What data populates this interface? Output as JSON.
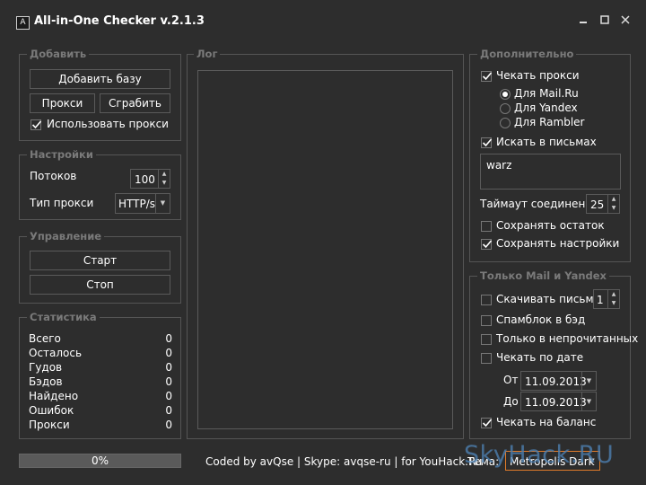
{
  "window": {
    "title": "All-in-One Checker v.2.1.3",
    "icon_glyph": "A"
  },
  "add_group": {
    "legend": "Добавить",
    "add_base": "Добавить базу",
    "proxy": "Прокси",
    "grab": "Сграбить",
    "use_proxy": "Использовать прокси",
    "use_proxy_checked": true
  },
  "settings_group": {
    "legend": "Настройки",
    "threads_label": "Потоков",
    "threads_value": "100",
    "proxy_type_label": "Тип прокси",
    "proxy_type_value": "HTTP/s"
  },
  "control_group": {
    "legend": "Управление",
    "start": "Старт",
    "stop": "Стоп"
  },
  "stats_group": {
    "legend": "Статистика",
    "rows": [
      {
        "label": "Всего",
        "value": "0"
      },
      {
        "label": "Осталось",
        "value": "0"
      },
      {
        "label": "Гудов",
        "value": "0"
      },
      {
        "label": "Бэдов",
        "value": "0"
      },
      {
        "label": "Найдено",
        "value": "0"
      },
      {
        "label": "Ошибок",
        "value": "0"
      },
      {
        "label": "Прокси",
        "value": "0"
      }
    ]
  },
  "log_group": {
    "legend": "Лог"
  },
  "extra_group": {
    "legend": "Дополнительно",
    "check_proxy": "Чекать прокси",
    "check_proxy_checked": true,
    "radios": [
      {
        "label": "Для Mail.Ru",
        "selected": true
      },
      {
        "label": "Для Yandex",
        "selected": false
      },
      {
        "label": "Для Rambler",
        "selected": false
      }
    ],
    "search_in_letters": "Искать в письмах",
    "search_in_letters_checked": true,
    "search_text": "warz",
    "timeout_label": "Таймаут соединения",
    "timeout_value": "25",
    "save_rest": "Сохранять остаток",
    "save_rest_checked": false,
    "save_settings": "Сохранять настройки",
    "save_settings_checked": true
  },
  "mail_yandex_group": {
    "legend": "Только Mail и Yandex",
    "download_letters": "Скачивать письма",
    "download_letters_checked": false,
    "download_count": "1",
    "spam_to_bad": "Спамблок в бэд",
    "spam_to_bad_checked": false,
    "only_unread": "Только в непрочитанных",
    "only_unread_checked": false,
    "check_by_date": "Чекать по дате",
    "check_by_date_checked": false,
    "from_label": "От",
    "from_date": "11.09.2013",
    "to_label": "До",
    "to_date": "11.09.2013",
    "check_balance": "Чекать на баланс",
    "check_balance_checked": true
  },
  "footer": {
    "progress_text": "0%",
    "progress": 0,
    "credits": "Coded by avQse | Skype: avqse-ru | for YouHack.Ru",
    "theme_label": "Тема:",
    "theme_value": "Metropolis Dark",
    "watermark": "SkyHack.RU"
  },
  "colors": {
    "background": "#2d2d2d",
    "border": "#555555",
    "legend": "#7a7a7a",
    "theme_border": "#e07b2a",
    "watermark": "#4d7fb0"
  }
}
